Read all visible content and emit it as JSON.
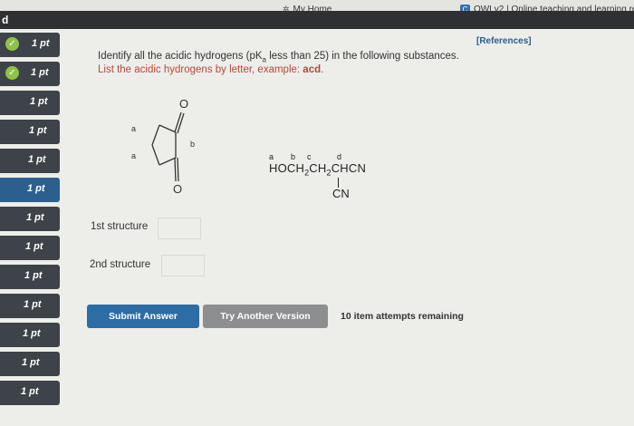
{
  "browser": {
    "tab_home_label": "My Home",
    "tab_owl_label": "OWLv2 | Online teaching and learning re",
    "owl_badge": "C",
    "left_letter": "d"
  },
  "sidebar": {
    "items": [
      {
        "label": "1 pt",
        "completed": true
      },
      {
        "label": "1 pt",
        "completed": true
      },
      {
        "label": "1 pt",
        "completed": false
      },
      {
        "label": "1 pt",
        "completed": false
      },
      {
        "label": "1 pt",
        "completed": false
      },
      {
        "label": "1 pt",
        "completed": false,
        "current": true
      },
      {
        "label": "1 pt",
        "completed": false
      },
      {
        "label": "1 pt",
        "completed": false
      },
      {
        "label": "1 pt",
        "completed": false
      },
      {
        "label": "1 pt",
        "completed": false
      },
      {
        "label": "1 pt",
        "completed": false
      },
      {
        "label": "1 pt",
        "completed": false
      },
      {
        "label": "1 pt",
        "completed": false
      }
    ],
    "colors": {
      "item": "#3d4348",
      "current": "#2d5f8e",
      "check": "#8fc24a"
    }
  },
  "question": {
    "references": "[References]",
    "line1_pre": "Identify all the acidic hydrogens (pK",
    "line1_sub": "a",
    "line1_post": " less than 25) in the following substances.",
    "line2_pre": "List the acidic hydrogens by letter, example: ",
    "line2_example": "acd",
    "line2_end": "."
  },
  "structure1": {
    "atom_o_top": "O",
    "atom_o_bottom": "O",
    "label_a_top": "a",
    "label_a_bottom": "a",
    "label_b": "b"
  },
  "structure2": {
    "label_a": "a",
    "label_b": "b",
    "label_c": "c",
    "label_d": "d",
    "formula_p1": "HOCH",
    "formula_sub1": "2",
    "formula_p2": "CH",
    "formula_sub2": "2",
    "formula_p3": "CHCN",
    "substituent": "CN"
  },
  "answers": {
    "first_label": "1st structure",
    "first_value": "",
    "second_label": "2nd structure",
    "second_value": ""
  },
  "actions": {
    "submit_label": "Submit Answer",
    "try_label": "Try Another Version",
    "attempts_text": "10 item attempts remaining"
  }
}
